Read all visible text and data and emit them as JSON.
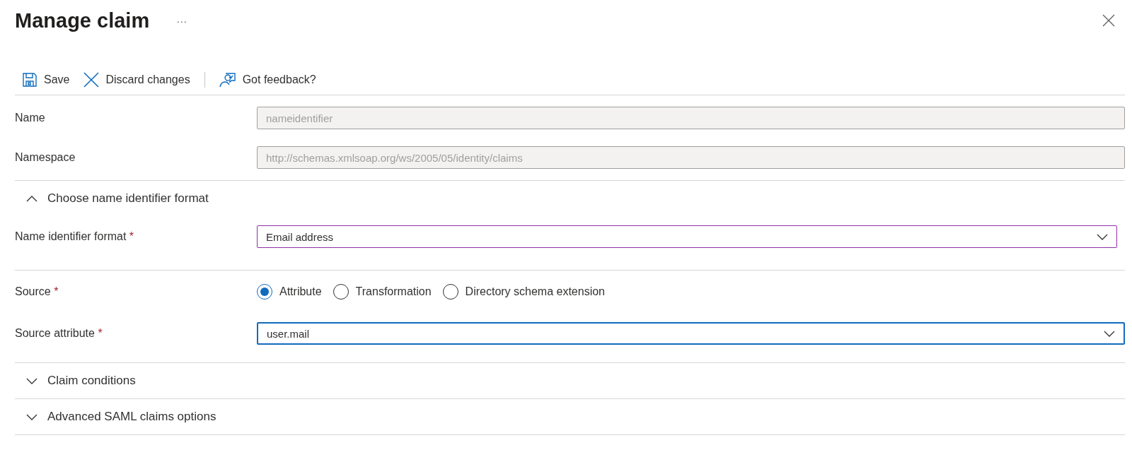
{
  "panel": {
    "title": "Manage claim",
    "more": "···"
  },
  "toolbar": [
    {
      "kind": "save",
      "label": "Save"
    },
    {
      "kind": "discard",
      "label": "Discard changes"
    },
    {
      "kind": "feedback",
      "label": "Got feedback?"
    }
  ],
  "fields": [
    {
      "label": "Name",
      "value": "nameidentifier",
      "disabled": true,
      "focused": false,
      "hovered": false
    },
    {
      "label": "Namespace",
      "value": "http://schemas.xmlsoap.org/ws/2005/05/identity/claims",
      "disabled": true,
      "focused": false,
      "hovered": false
    }
  ],
  "format_section": {
    "title": "Choose name identifier format",
    "expanded": true,
    "field": {
      "label": "Name identifier format",
      "required_mark": "*",
      "value": "Email address",
      "disabled": false,
      "focused": false,
      "hovered": true
    }
  },
  "source": {
    "label": "Source",
    "required_mark": "*",
    "options": [
      {
        "label": "Attribute",
        "selected": true
      },
      {
        "label": "Transformation",
        "selected": false
      },
      {
        "label": "Directory schema extension",
        "selected": false
      }
    ]
  },
  "source_attribute": {
    "label": "Source attribute",
    "required_mark": "*",
    "value": "user.mail",
    "disabled": false,
    "focused": true
  },
  "sections": [
    {
      "title": "Claim conditions",
      "expanded": false
    },
    {
      "title": "Advanced SAML claims options",
      "expanded": false
    }
  ]
}
